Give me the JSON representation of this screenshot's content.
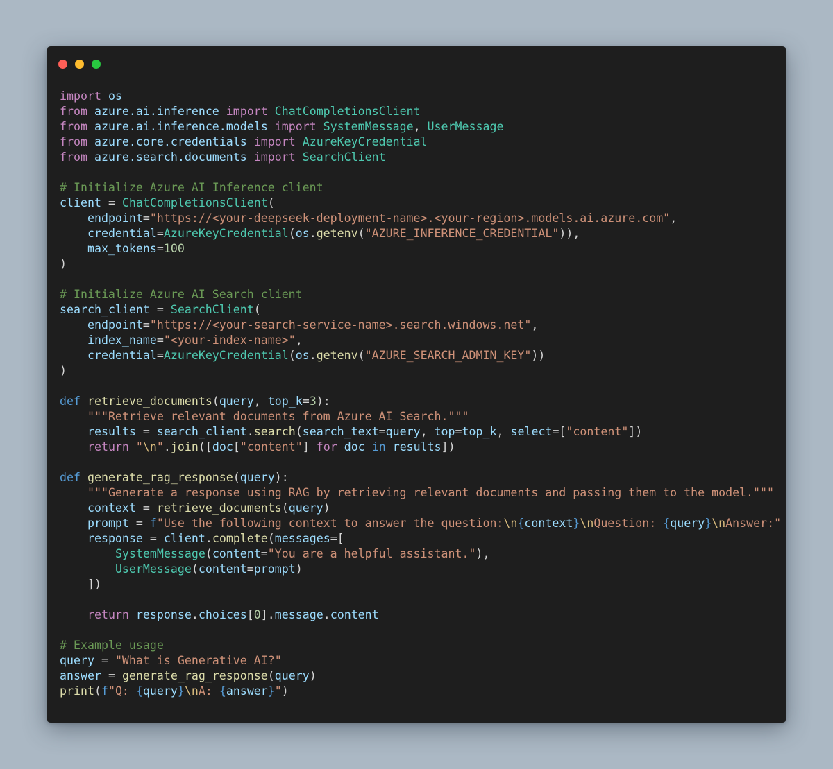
{
  "window": {
    "controls": {
      "close": "close",
      "minimize": "minimize",
      "maximize": "maximize"
    },
    "colors": {
      "background": "#abb8c4",
      "editor": "#1e1e1e",
      "close": "#ff5f57",
      "minimize": "#febc2e",
      "maximize": "#28c840"
    }
  },
  "code": {
    "language": "python",
    "lines": [
      [
        [
          "kw",
          "import"
        ],
        [
          "pun",
          " "
        ],
        [
          "mod",
          "os"
        ]
      ],
      [
        [
          "kw",
          "from"
        ],
        [
          "pun",
          " "
        ],
        [
          "mod",
          "azure.ai.inference"
        ],
        [
          "pun",
          " "
        ],
        [
          "kw",
          "import"
        ],
        [
          "pun",
          " "
        ],
        [
          "cls",
          "ChatCompletionsClient"
        ]
      ],
      [
        [
          "kw",
          "from"
        ],
        [
          "pun",
          " "
        ],
        [
          "mod",
          "azure.ai.inference.models"
        ],
        [
          "pun",
          " "
        ],
        [
          "kw",
          "import"
        ],
        [
          "pun",
          " "
        ],
        [
          "cls",
          "SystemMessage"
        ],
        [
          "pun",
          ", "
        ],
        [
          "cls",
          "UserMessage"
        ]
      ],
      [
        [
          "kw",
          "from"
        ],
        [
          "pun",
          " "
        ],
        [
          "mod",
          "azure.core.credentials"
        ],
        [
          "pun",
          " "
        ],
        [
          "kw",
          "import"
        ],
        [
          "pun",
          " "
        ],
        [
          "cls",
          "AzureKeyCredential"
        ]
      ],
      [
        [
          "kw",
          "from"
        ],
        [
          "pun",
          " "
        ],
        [
          "mod",
          "azure.search.documents"
        ],
        [
          "pun",
          " "
        ],
        [
          "kw",
          "import"
        ],
        [
          "pun",
          " "
        ],
        [
          "cls",
          "SearchClient"
        ]
      ],
      [],
      [
        [
          "cmt",
          "# Initialize Azure AI Inference client"
        ]
      ],
      [
        [
          "var",
          "client"
        ],
        [
          "pun",
          " = "
        ],
        [
          "cls",
          "ChatCompletionsClient"
        ],
        [
          "pun",
          "("
        ]
      ],
      [
        [
          "pun",
          "    "
        ],
        [
          "var",
          "endpoint"
        ],
        [
          "pun",
          "="
        ],
        [
          "str",
          "\"https://<your-deepseek-deployment-name>.<your-region>.models.ai.azure.com\""
        ],
        [
          "pun",
          ","
        ]
      ],
      [
        [
          "pun",
          "    "
        ],
        [
          "var",
          "credential"
        ],
        [
          "pun",
          "="
        ],
        [
          "cls",
          "AzureKeyCredential"
        ],
        [
          "pun",
          "("
        ],
        [
          "mod",
          "os"
        ],
        [
          "pun",
          "."
        ],
        [
          "fn",
          "getenv"
        ],
        [
          "pun",
          "("
        ],
        [
          "str",
          "\"AZURE_INFERENCE_CREDENTIAL\""
        ],
        [
          "pun",
          ")),"
        ]
      ],
      [
        [
          "pun",
          "    "
        ],
        [
          "var",
          "max_tokens"
        ],
        [
          "pun",
          "="
        ],
        [
          "num",
          "100"
        ]
      ],
      [
        [
          "pun",
          ")"
        ]
      ],
      [],
      [
        [
          "cmt",
          "# Initialize Azure AI Search client"
        ]
      ],
      [
        [
          "var",
          "search_client"
        ],
        [
          "pun",
          " = "
        ],
        [
          "cls",
          "SearchClient"
        ],
        [
          "pun",
          "("
        ]
      ],
      [
        [
          "pun",
          "    "
        ],
        [
          "var",
          "endpoint"
        ],
        [
          "pun",
          "="
        ],
        [
          "str",
          "\"https://<your-search-service-name>.search.windows.net\""
        ],
        [
          "pun",
          ","
        ]
      ],
      [
        [
          "pun",
          "    "
        ],
        [
          "var",
          "index_name"
        ],
        [
          "pun",
          "="
        ],
        [
          "str",
          "\"<your-index-name>\""
        ],
        [
          "pun",
          ","
        ]
      ],
      [
        [
          "pun",
          "    "
        ],
        [
          "var",
          "credential"
        ],
        [
          "pun",
          "="
        ],
        [
          "cls",
          "AzureKeyCredential"
        ],
        [
          "pun",
          "("
        ],
        [
          "mod",
          "os"
        ],
        [
          "pun",
          "."
        ],
        [
          "fn",
          "getenv"
        ],
        [
          "pun",
          "("
        ],
        [
          "str",
          "\"AZURE_SEARCH_ADMIN_KEY\""
        ],
        [
          "pun",
          "))"
        ]
      ],
      [
        [
          "pun",
          ")"
        ]
      ],
      [],
      [
        [
          "def",
          "def"
        ],
        [
          "pun",
          " "
        ],
        [
          "fn",
          "retrieve_documents"
        ],
        [
          "pun",
          "("
        ],
        [
          "var",
          "query"
        ],
        [
          "pun",
          ", "
        ],
        [
          "var",
          "top_k"
        ],
        [
          "pun",
          "="
        ],
        [
          "num",
          "3"
        ],
        [
          "pun",
          "):"
        ]
      ],
      [
        [
          "pun",
          "    "
        ],
        [
          "str",
          "\"\"\"Retrieve relevant documents from Azure AI Search.\"\"\""
        ]
      ],
      [
        [
          "pun",
          "    "
        ],
        [
          "var",
          "results"
        ],
        [
          "pun",
          " = "
        ],
        [
          "var",
          "search_client"
        ],
        [
          "pun",
          "."
        ],
        [
          "fn",
          "search"
        ],
        [
          "pun",
          "("
        ],
        [
          "var",
          "search_text"
        ],
        [
          "pun",
          "="
        ],
        [
          "var",
          "query"
        ],
        [
          "pun",
          ", "
        ],
        [
          "var",
          "top"
        ],
        [
          "pun",
          "="
        ],
        [
          "var",
          "top_k"
        ],
        [
          "pun",
          ", "
        ],
        [
          "var",
          "select"
        ],
        [
          "pun",
          "=["
        ],
        [
          "str",
          "\"content\""
        ],
        [
          "pun",
          "])"
        ]
      ],
      [
        [
          "pun",
          "    "
        ],
        [
          "kw",
          "return"
        ],
        [
          "pun",
          " "
        ],
        [
          "str",
          "\""
        ],
        [
          "esc",
          "\\n"
        ],
        [
          "str",
          "\""
        ],
        [
          "pun",
          "."
        ],
        [
          "fn",
          "join"
        ],
        [
          "pun",
          "(["
        ],
        [
          "var",
          "doc"
        ],
        [
          "pun",
          "["
        ],
        [
          "str",
          "\"content\""
        ],
        [
          "pun",
          "] "
        ],
        [
          "kw",
          "for"
        ],
        [
          "pun",
          " "
        ],
        [
          "var",
          "doc"
        ],
        [
          "pun",
          " "
        ],
        [
          "def",
          "in"
        ],
        [
          "pun",
          " "
        ],
        [
          "var",
          "results"
        ],
        [
          "pun",
          "])"
        ]
      ],
      [],
      [
        [
          "def",
          "def"
        ],
        [
          "pun",
          " "
        ],
        [
          "fn",
          "generate_rag_response"
        ],
        [
          "pun",
          "("
        ],
        [
          "var",
          "query"
        ],
        [
          "pun",
          "):"
        ]
      ],
      [
        [
          "pun",
          "    "
        ],
        [
          "str",
          "\"\"\"Generate a response using RAG by retrieving relevant documents and passing them to the model.\"\"\""
        ]
      ],
      [
        [
          "pun",
          "    "
        ],
        [
          "var",
          "context"
        ],
        [
          "pun",
          " = "
        ],
        [
          "fn",
          "retrieve_documents"
        ],
        [
          "pun",
          "("
        ],
        [
          "var",
          "query"
        ],
        [
          "pun",
          ")"
        ]
      ],
      [
        [
          "pun",
          "    "
        ],
        [
          "var",
          "prompt"
        ],
        [
          "pun",
          " = "
        ],
        [
          "def",
          "f"
        ],
        [
          "str",
          "\"Use the following context to answer the question:"
        ],
        [
          "esc",
          "\\n"
        ],
        [
          "def",
          "{"
        ],
        [
          "var",
          "context"
        ],
        [
          "def",
          "}"
        ],
        [
          "esc",
          "\\n"
        ],
        [
          "str",
          "Question: "
        ],
        [
          "def",
          "{"
        ],
        [
          "var",
          "query"
        ],
        [
          "def",
          "}"
        ],
        [
          "esc",
          "\\n"
        ],
        [
          "str",
          "Answer:\""
        ]
      ],
      [
        [
          "pun",
          "    "
        ],
        [
          "var",
          "response"
        ],
        [
          "pun",
          " = "
        ],
        [
          "var",
          "client"
        ],
        [
          "pun",
          "."
        ],
        [
          "fn",
          "complete"
        ],
        [
          "pun",
          "("
        ],
        [
          "var",
          "messages"
        ],
        [
          "pun",
          "=["
        ]
      ],
      [
        [
          "pun",
          "        "
        ],
        [
          "cls",
          "SystemMessage"
        ],
        [
          "pun",
          "("
        ],
        [
          "var",
          "content"
        ],
        [
          "pun",
          "="
        ],
        [
          "str",
          "\"You are a helpful assistant.\""
        ],
        [
          "pun",
          "),"
        ]
      ],
      [
        [
          "pun",
          "        "
        ],
        [
          "cls",
          "UserMessage"
        ],
        [
          "pun",
          "("
        ],
        [
          "var",
          "content"
        ],
        [
          "pun",
          "="
        ],
        [
          "var",
          "prompt"
        ],
        [
          "pun",
          ")"
        ]
      ],
      [
        [
          "pun",
          "    ])"
        ]
      ],
      [],
      [
        [
          "pun",
          "    "
        ],
        [
          "kw",
          "return"
        ],
        [
          "pun",
          " "
        ],
        [
          "var",
          "response"
        ],
        [
          "pun",
          "."
        ],
        [
          "var",
          "choices"
        ],
        [
          "pun",
          "["
        ],
        [
          "num",
          "0"
        ],
        [
          "pun",
          "]."
        ],
        [
          "var",
          "message"
        ],
        [
          "pun",
          "."
        ],
        [
          "var",
          "content"
        ]
      ],
      [],
      [
        [
          "cmt",
          "# Example usage"
        ]
      ],
      [
        [
          "var",
          "query"
        ],
        [
          "pun",
          " = "
        ],
        [
          "str",
          "\"What is Generative AI?\""
        ]
      ],
      [
        [
          "var",
          "answer"
        ],
        [
          "pun",
          " = "
        ],
        [
          "fn",
          "generate_rag_response"
        ],
        [
          "pun",
          "("
        ],
        [
          "var",
          "query"
        ],
        [
          "pun",
          ")"
        ]
      ],
      [
        [
          "fn",
          "print"
        ],
        [
          "pun",
          "("
        ],
        [
          "def",
          "f"
        ],
        [
          "str",
          "\"Q: "
        ],
        [
          "def",
          "{"
        ],
        [
          "var",
          "query"
        ],
        [
          "def",
          "}"
        ],
        [
          "esc",
          "\\n"
        ],
        [
          "str",
          "A: "
        ],
        [
          "def",
          "{"
        ],
        [
          "var",
          "answer"
        ],
        [
          "def",
          "}"
        ],
        [
          "str",
          "\""
        ],
        [
          "pun",
          ")"
        ]
      ]
    ]
  }
}
